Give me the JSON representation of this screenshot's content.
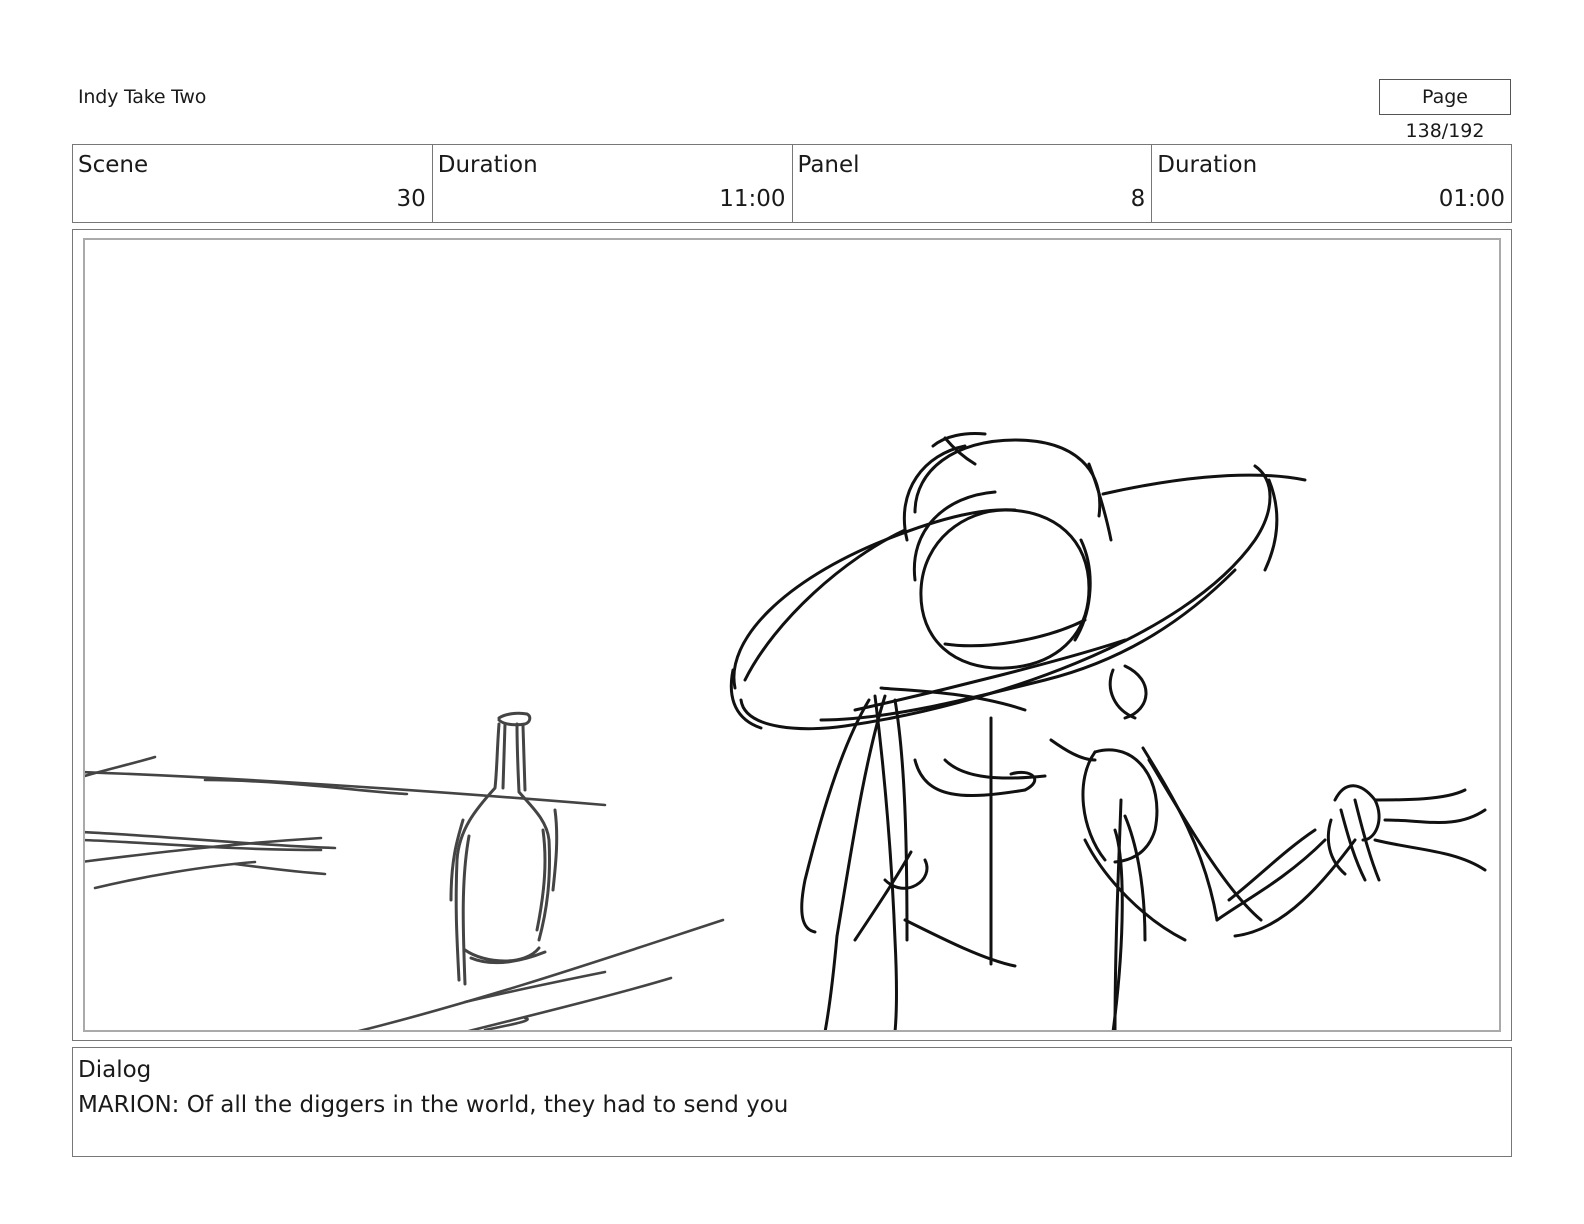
{
  "header": {
    "title": "Indy Take Two",
    "page": "Page 138/192"
  },
  "info": [
    {
      "label": "Scene",
      "value": "30"
    },
    {
      "label": "Duration",
      "value": "11:00"
    },
    {
      "label": "Panel",
      "value": "8"
    },
    {
      "label": "Duration",
      "value": "01:00"
    }
  ],
  "dialog": {
    "label": "Dialog",
    "text": "MARION: Of all the diggers in the world, they had to send you"
  },
  "sketch": {
    "subjects": [
      "bottle",
      "table-edge",
      "figure-with-wide-brim-hat"
    ],
    "stroke_colors": {
      "ink": "#111111",
      "pencil": "#444444"
    }
  }
}
